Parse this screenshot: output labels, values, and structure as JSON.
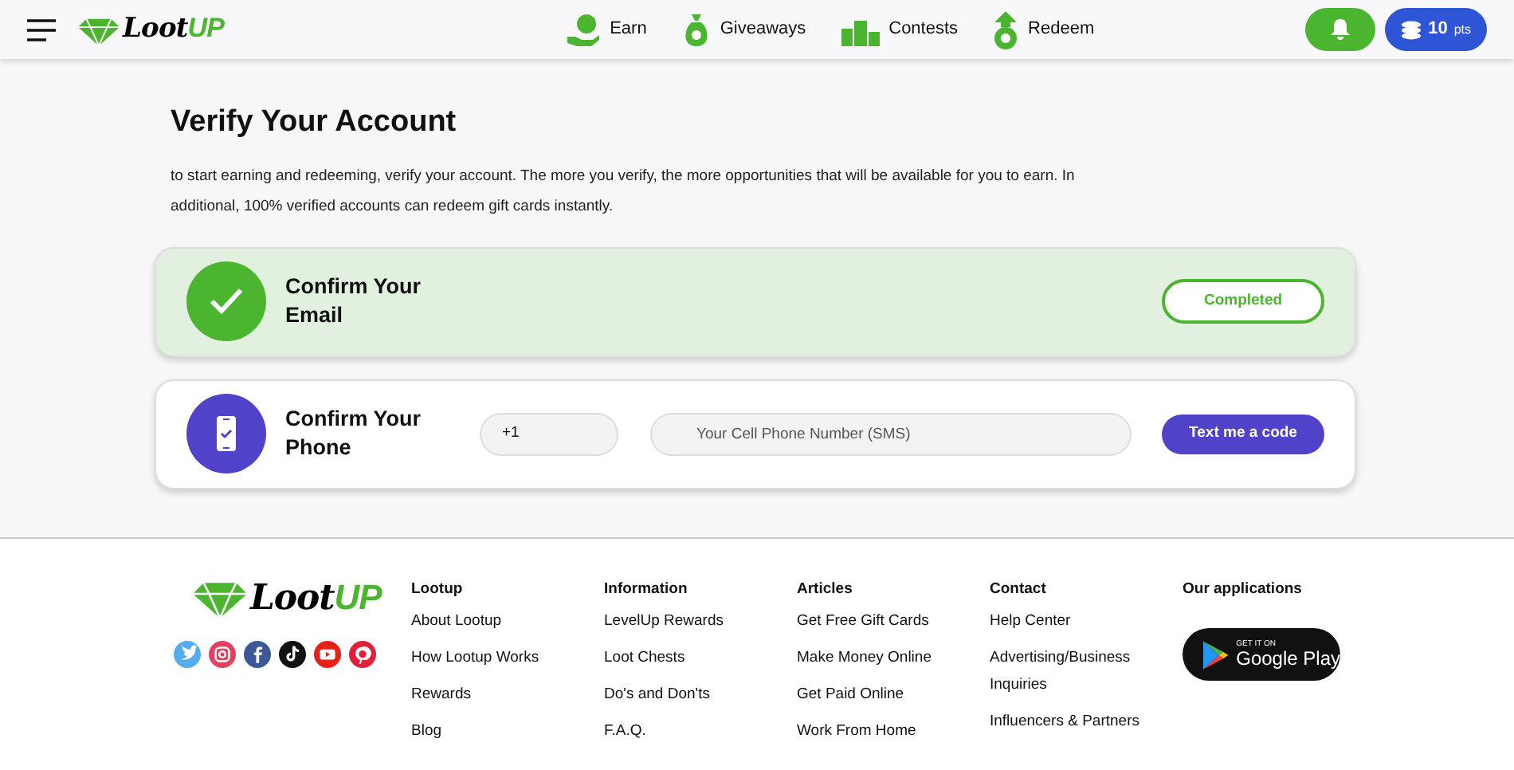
{
  "header": {
    "logo": {
      "part_1": "Loot",
      "part_2": "UP"
    },
    "nav": [
      {
        "label": "Earn",
        "kind": "earn"
      },
      {
        "label": "Giveaways",
        "kind": "giveaways"
      },
      {
        "label": "Contests",
        "kind": "contests"
      },
      {
        "label": "Redeem",
        "kind": "redeem"
      }
    ],
    "points": {
      "value": "10",
      "unit": "pts"
    }
  },
  "page": {
    "title": "Verify Your Account",
    "intro": "to start earning and redeeming, verify your account. The more you verify, the more opportunities that will be available for you to earn. In additional, 100% verified accounts can redeem gift cards instantly."
  },
  "steps": [
    {
      "kind": "email",
      "title": "Confirm Your Email",
      "completed": true,
      "status": "Completed"
    },
    {
      "kind": "phone",
      "title": "Confirm Your Phone",
      "completed": false,
      "country_code": "+1",
      "placeholder": "Your Cell Phone Number (SMS)",
      "button": "Text me a code"
    }
  ],
  "footer": {
    "logo": {
      "part_1": "Loot",
      "part_2": "UP"
    },
    "social": [
      {
        "kind": "twitter",
        "color": "#55acee"
      },
      {
        "kind": "instagram",
        "color": "#e4405f"
      },
      {
        "kind": "facebook",
        "color": "#3b5998"
      },
      {
        "kind": "tiktok",
        "color": "#111111"
      },
      {
        "kind": "youtube",
        "color": "#e62117"
      },
      {
        "kind": "pinterest",
        "color": "#e0203a"
      }
    ],
    "columns": [
      {
        "heading": "Lootup",
        "links": [
          "About Lootup",
          "How Lootup Works",
          "Rewards",
          "Blog"
        ]
      },
      {
        "heading": "Information",
        "links": [
          "LevelUp Rewards",
          "Loot Chests",
          "Do's and Don'ts",
          "F.A.Q."
        ]
      },
      {
        "heading": "Articles",
        "links": [
          "Get Free Gift Cards",
          "Make Money Online",
          "Get Paid Online",
          "Work From Home"
        ]
      },
      {
        "heading": "Contact",
        "links": [
          "Help Center",
          "Advertising/Business Inquiries",
          "Influencers & Partners"
        ]
      }
    ],
    "apps": {
      "heading": "Our applications",
      "badge_small": "GET IT ON",
      "badge_large": "Google Play"
    }
  }
}
